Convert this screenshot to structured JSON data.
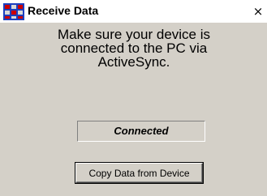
{
  "window": {
    "title": "Receive Data",
    "close_label": "×"
  },
  "message": {
    "lines": [
      "Make sure your device is",
      "connected to the PC via",
      "ActiveSync."
    ]
  },
  "status": {
    "text": "Connected"
  },
  "actions": {
    "copy_label": "Copy Data from Device"
  },
  "icons": {
    "app": "data-grid-icon",
    "close": "close-icon"
  },
  "colors": {
    "dialog_background": "#d4d0c8",
    "icon_red": "#cc0000",
    "icon_blue": "#1c3fbf"
  }
}
